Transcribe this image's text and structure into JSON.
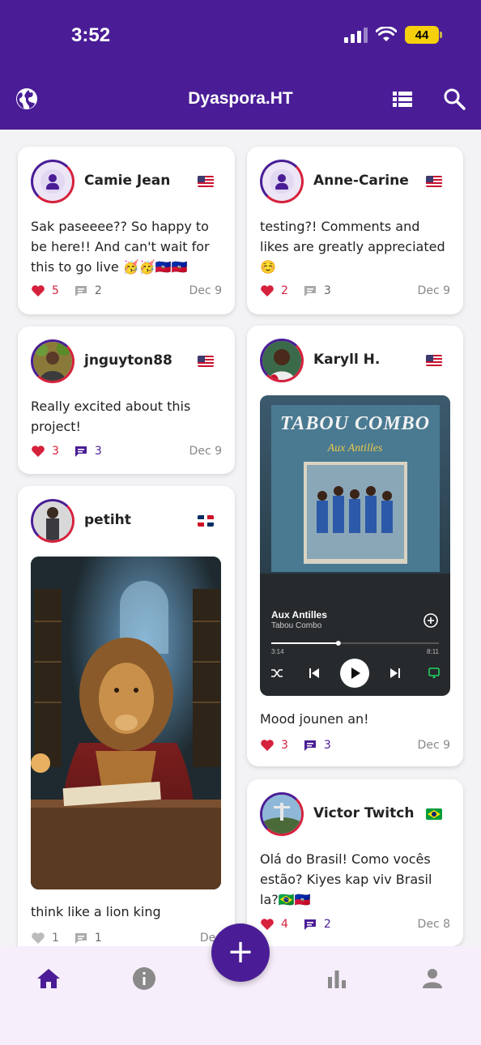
{
  "status_bar": {
    "time": "3:52",
    "battery": "44"
  },
  "header": {
    "title": "Dyaspora.HT",
    "globe_icon": "globe-icon",
    "list_icon": "list-view-icon",
    "search_icon": "search-icon"
  },
  "colors": {
    "primary": "#4a1d96",
    "like": "#d6213d",
    "comment_active": "#4a1d96"
  },
  "posts": [
    {
      "user": "Camie Jean",
      "flag": "us-flag",
      "text": "Sak paseeee?? So happy to be here!! And can't wait for this to go live 🥳🥳🇭🇹🇭🇹",
      "likes": "5",
      "comments": "2",
      "date": "Dec 9"
    },
    {
      "user": "Anne-Carine",
      "flag": "us-flag",
      "text": "testing?! Comments and likes are greatly appreciated ☺️",
      "likes": "2",
      "comments": "3",
      "date": "Dec 9"
    },
    {
      "user": "jnguyton88",
      "flag": "us-flag",
      "text": "Really excited about this project!",
      "likes": "3",
      "comments": "3",
      "date": "Dec 9"
    },
    {
      "user": "Karyll H.",
      "flag": "us-flag",
      "text": "Mood jounen an!",
      "likes": "3",
      "comments": "3",
      "date": "Dec 9",
      "media": {
        "album_title": "Aux Antilles",
        "album_artist": "Tabou Combo",
        "cover_text": "TABOU COMBO",
        "cover_sub": "Aux Antilles",
        "time_start": "3:14",
        "time_end": "8:11",
        "progress": 0.4
      }
    },
    {
      "user": "petiht",
      "flag": "do-flag",
      "text": "think like a lion king",
      "likes": "1",
      "comments": "1",
      "date": "Dec"
    },
    {
      "user": "Victor Twitch",
      "flag": "br-flag",
      "text": "Olá do Brasil! Como vocês estão? Kiyes kap viv Brasil la?🇧🇷🇭🇹",
      "likes": "4",
      "comments": "2",
      "date": "Dec 8"
    }
  ],
  "fab": {
    "label": "+"
  },
  "nav": {
    "items": [
      "home-icon",
      "info-icon",
      "stats-icon",
      "profile-icon"
    ]
  }
}
